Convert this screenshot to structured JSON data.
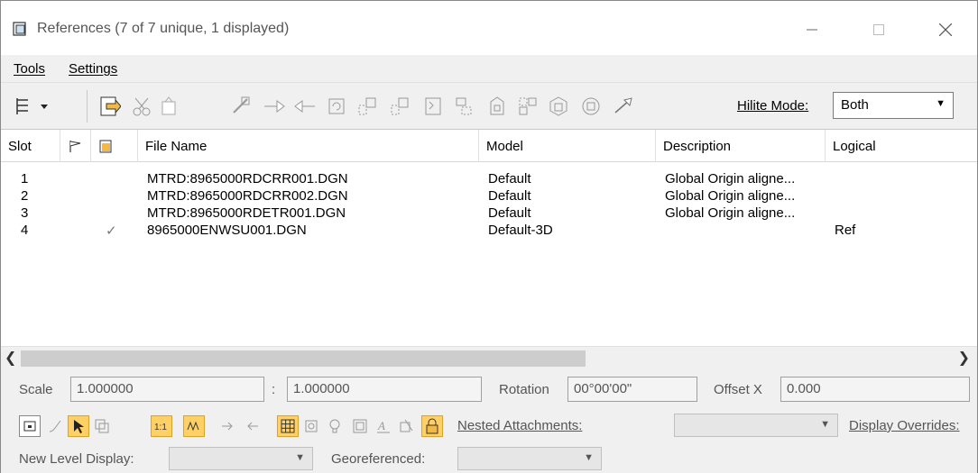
{
  "window": {
    "title": "References (7 of 7 unique, 1 displayed)"
  },
  "menu": [
    {
      "label": "Tools"
    },
    {
      "label": "Settings"
    }
  ],
  "toolbar": {
    "hilite_label": "Hilite Mode:",
    "hilite_value": "Both"
  },
  "table": {
    "headers": {
      "slot": "Slot",
      "file_name": "File Name",
      "model": "Model",
      "description": "Description",
      "logical": "Logical"
    },
    "rows": [
      {
        "slot": "1",
        "check": "",
        "file": "MTRD:8965000RDCRR001.DGN",
        "model": "Default",
        "description": "Global Origin aligne...",
        "logical": ""
      },
      {
        "slot": "2",
        "check": "",
        "file": "MTRD:8965000RDCRR002.DGN",
        "model": "Default",
        "description": "Global Origin aligne...",
        "logical": ""
      },
      {
        "slot": "3",
        "check": "",
        "file": "MTRD:8965000RDETR001.DGN",
        "model": "Default",
        "description": "Global Origin aligne...",
        "logical": ""
      },
      {
        "slot": "4",
        "check": "✓",
        "file": "8965000ENWSU001.DGN",
        "model": "Default-3D",
        "description": "",
        "logical": "Ref"
      }
    ]
  },
  "props": {
    "scale_label": "Scale",
    "scale_value1": "1.000000",
    "scale_sep": ":",
    "scale_value2": "1.000000",
    "rotation_label": "Rotation",
    "rotation_value": "00°00'00\"",
    "offset_label": "Offset X",
    "offset_value": "0.000",
    "nested_label": "Nested Attachments:",
    "display_overrides_label": "Display Overrides:",
    "new_level_label": "New Level Display:",
    "georef_label": "Georeferenced:"
  },
  "colors": {
    "active_icon": "#ffd066",
    "window_bg": "#f0f0f0"
  }
}
